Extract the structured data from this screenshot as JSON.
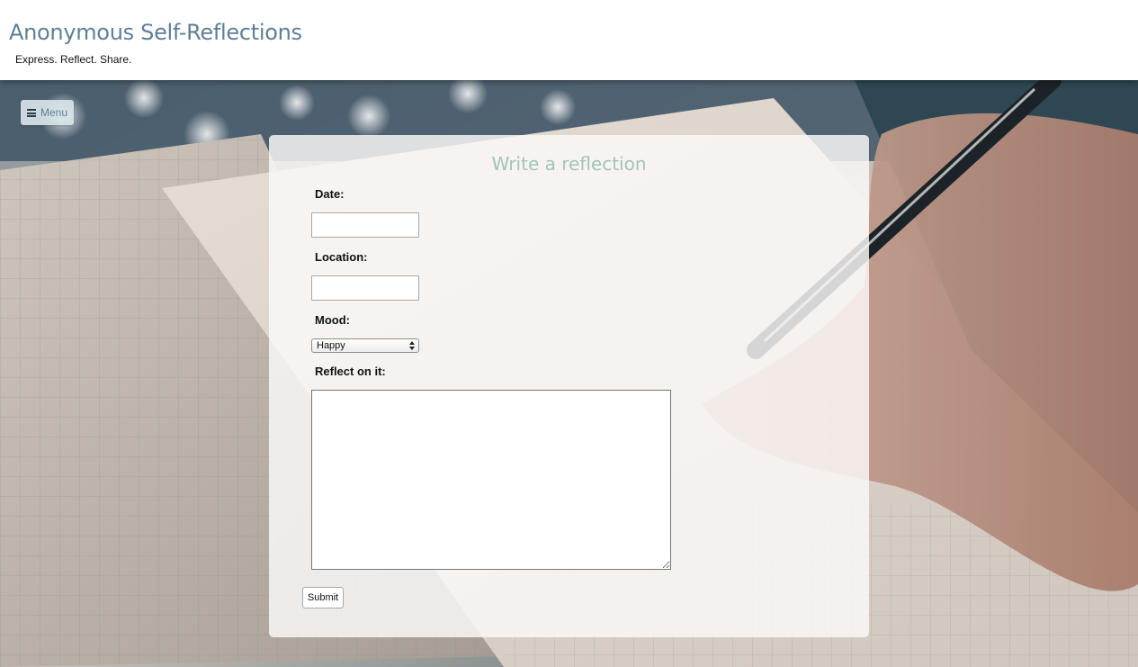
{
  "header": {
    "title": "Anonymous Self-Reflections",
    "tagline": "Express. Reflect. Share."
  },
  "menu": {
    "label": "Menu",
    "icon": "hamburger-icon"
  },
  "form": {
    "heading": "Write a reflection",
    "date_label": "Date:",
    "date_value": "",
    "location_label": "Location:",
    "location_value": "",
    "mood_label": "Mood:",
    "mood_selected": "Happy",
    "reflection_label": "Reflect on it:",
    "reflection_value": "",
    "submit_label": "Submit"
  },
  "colors": {
    "title": "#5e7f96",
    "heading": "#a4c4b8",
    "menu_bg": "#d6e4e8"
  }
}
